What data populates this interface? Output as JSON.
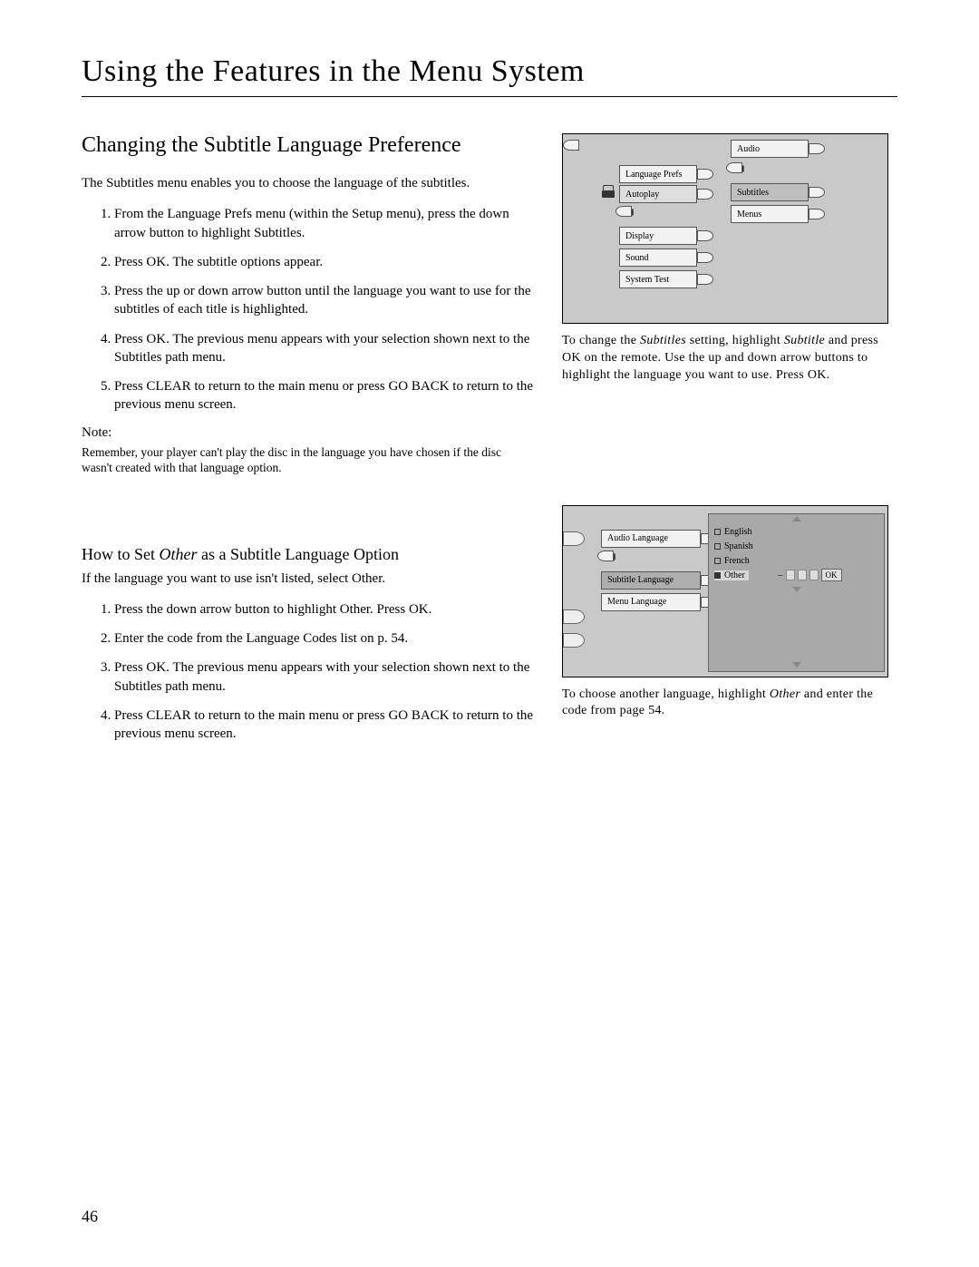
{
  "page_title": "Using the Features in the Menu System",
  "page_number": "46",
  "section1": {
    "heading": "Changing the Subtitle Language Preference",
    "intro": "The Subtitles menu enables you to choose the language of the subtitles.",
    "steps": [
      "From the Language Prefs menu (within the Setup menu), press the down arrow button to highlight Subtitles.",
      "Press OK. The subtitle options appear.",
      "Press the up or down arrow button until the language you want to use for the subtitles of each title is highlighted.",
      "Press OK. The previous menu appears with your selection shown next to the Subtitles path menu.",
      "Press CLEAR to return to the main menu or press GO BACK to return to the previous menu screen."
    ],
    "note_label": "Note:",
    "note_text": "Remember, your player can't play the disc in the language you have chosen if the disc wasn't created with that language option.",
    "caption_pre": "To change the ",
    "caption_em1": "Subtitles",
    "caption_mid": " setting, highlight ",
    "caption_em2": "Subtitle",
    "caption_post": " and press OK on the remote. Use the up and down arrow buttons to highlight the language you want to use. Press OK."
  },
  "section2": {
    "heading_pre": "How to Set ",
    "heading_em": "Other",
    "heading_post": " as a Subtitle Language Option",
    "intro": "If the language you want to use isn't listed, select Other.",
    "steps": [
      "Press the down arrow button to highlight Other. Press OK.",
      "Enter the code from the Language Codes list on p. 54.",
      "Press OK. The previous menu appears with your selection shown next to the Subtitles path menu.",
      "Press CLEAR to return to the main menu or press GO BACK to return to the previous menu screen."
    ],
    "caption_pre": "To choose another language, highlight ",
    "caption_em": "Other",
    "caption_post": " and enter the code from page 54."
  },
  "fig1": {
    "left_items": [
      "Language Prefs",
      "Autoplay",
      "Display",
      "Sound",
      "System Test"
    ],
    "right_items": [
      "Audio",
      "Subtitles",
      "Menus"
    ]
  },
  "fig2": {
    "left_items": [
      "Audio Language",
      "Subtitle Language",
      "Menu Language"
    ],
    "options": [
      "English",
      "Spanish",
      "French",
      "Other"
    ],
    "ok": "OK"
  }
}
